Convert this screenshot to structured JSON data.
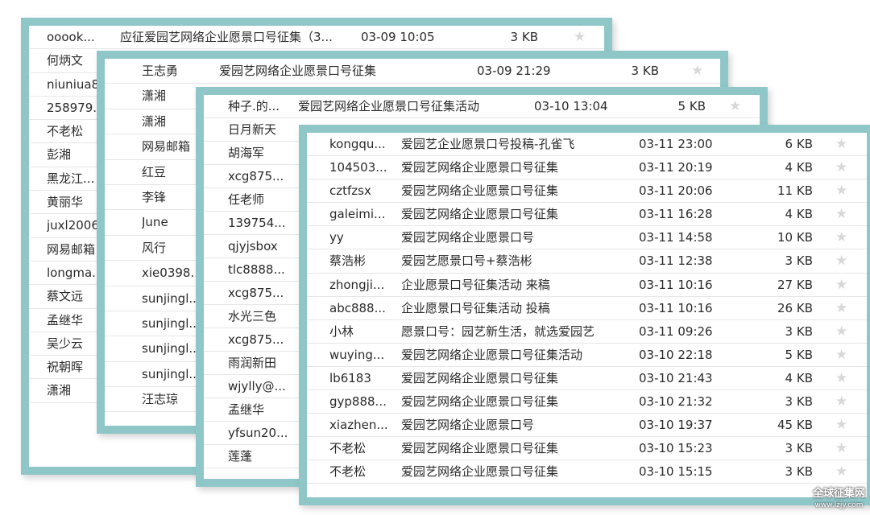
{
  "window1": {
    "rows": [
      {
        "sender": "ooook...",
        "subject": "应征爱园艺网络企业愿景口号征集（3...",
        "date": "03-09 10:05",
        "size": "3 KB"
      },
      {
        "sender": "何炳文"
      },
      {
        "sender": "niuniua8"
      },
      {
        "sender": "258979..."
      },
      {
        "sender": "不老松"
      },
      {
        "sender": "彭湘"
      },
      {
        "sender": "黑龙江..."
      },
      {
        "sender": "黄丽华"
      },
      {
        "sender": "juxl2006"
      },
      {
        "sender": "网易邮箱"
      },
      {
        "sender": "longma..."
      },
      {
        "sender": "蔡文远"
      },
      {
        "sender": "孟继华"
      },
      {
        "sender": "吴少云"
      },
      {
        "sender": "祝朝晖"
      },
      {
        "sender": "潇湘"
      }
    ]
  },
  "window2": {
    "rows": [
      {
        "sender": "王志勇",
        "subject": "爱园艺网络企业愿景口号征集",
        "date": "03-09 21:29",
        "size": "3 KB"
      },
      {
        "sender": "潇湘"
      },
      {
        "sender": "潇湘"
      },
      {
        "sender": "网易邮箱"
      },
      {
        "sender": "红豆"
      },
      {
        "sender": "李锋"
      },
      {
        "sender": "June"
      },
      {
        "sender": "风行"
      },
      {
        "sender": "xie0398..."
      },
      {
        "sender": "sunjingl..."
      },
      {
        "sender": "sunjingl..."
      },
      {
        "sender": "sunjingl..."
      },
      {
        "sender": "sunjingl..."
      },
      {
        "sender": "汪志琼"
      }
    ]
  },
  "window3": {
    "rows": [
      {
        "sender": "种子.的...",
        "subject": "爱园艺网络企业愿景口号征集活动",
        "date": "03-10 13:04",
        "size": "5 KB"
      },
      {
        "sender": "日月新天"
      },
      {
        "sender": "胡海军"
      },
      {
        "sender": "xcg875..."
      },
      {
        "sender": "任老师"
      },
      {
        "sender": "139754..."
      },
      {
        "sender": "qjyjsbox"
      },
      {
        "sender": "tlc8888..."
      },
      {
        "sender": "xcg875..."
      },
      {
        "sender": "水光三色"
      },
      {
        "sender": "xcg875..."
      },
      {
        "sender": "雨润新田"
      },
      {
        "sender": "wjylly@..."
      },
      {
        "sender": "孟继华"
      },
      {
        "sender": "yfsun20..."
      },
      {
        "sender": "莲蓬"
      }
    ]
  },
  "window4": {
    "rows": [
      {
        "sender": "kongqu...",
        "subject": "爱园艺企业愿景口号投稿-孔雀飞",
        "date": "03-11 23:00",
        "size": "6 KB"
      },
      {
        "sender": "104503...",
        "subject": "爱园艺网络企业愿景口号征集",
        "date": "03-11 20:19",
        "size": "4 KB"
      },
      {
        "sender": "cztfzsx",
        "subject": "爱园艺网络企业愿景口号征集",
        "date": "03-11 20:06",
        "size": "11 KB"
      },
      {
        "sender": "galeimi...",
        "subject": " 爱园艺网络企业愿景口号征集",
        "date": "03-11 16:28",
        "size": "4 KB"
      },
      {
        "sender": "yy",
        "subject": "爱园艺网络企业愿景口号",
        "date": "03-11 14:58",
        "size": "10 KB"
      },
      {
        "sender": "蔡浩彬",
        "subject": "爱园艺愿景口号+蔡浩彬",
        "date": "03-11 12:38",
        "size": "3 KB"
      },
      {
        "sender": "zhongji...",
        "subject": "企业愿景口号征集活动 来稿",
        "date": "03-11 10:16",
        "size": "27 KB"
      },
      {
        "sender": "abc888...",
        "subject": "企业愿景口号征集活动 投稿",
        "date": "03-11 10:16",
        "size": "26 KB"
      },
      {
        "sender": "小林",
        "subject": "愿景口号：园艺新生活，就选爱园艺",
        "date": "03-11 09:26",
        "size": "3 KB"
      },
      {
        "sender": "wuying...",
        "subject": "爱园艺网络企业愿景口号征集活动",
        "date": "03-10 22:18",
        "size": "5 KB"
      },
      {
        "sender": "lb6183",
        "subject": "爱园艺网络企业愿景口号征集",
        "date": "03-10 21:43",
        "size": "4 KB"
      },
      {
        "sender": "gyp888...",
        "subject": "爱园艺网络企业愿景口号征集",
        "date": "03-10 21:32",
        "size": "3 KB"
      },
      {
        "sender": "xiazhen...",
        "subject": "爱园艺网络企业愿景口号",
        "date": "03-10 19:37",
        "size": "45 KB"
      },
      {
        "sender": "不老松",
        "subject": "爱园艺网络企业愿景口号征集",
        "date": "03-10 15:23",
        "size": "3 KB"
      },
      {
        "sender": "不老松",
        "subject": "爱园艺网络企业愿景口号征集",
        "date": "03-10 15:15",
        "size": "3 KB"
      }
    ]
  },
  "star_glyph": "★",
  "watermark": {
    "name": "全球征集网",
    "url": "www.lzjy.com"
  }
}
